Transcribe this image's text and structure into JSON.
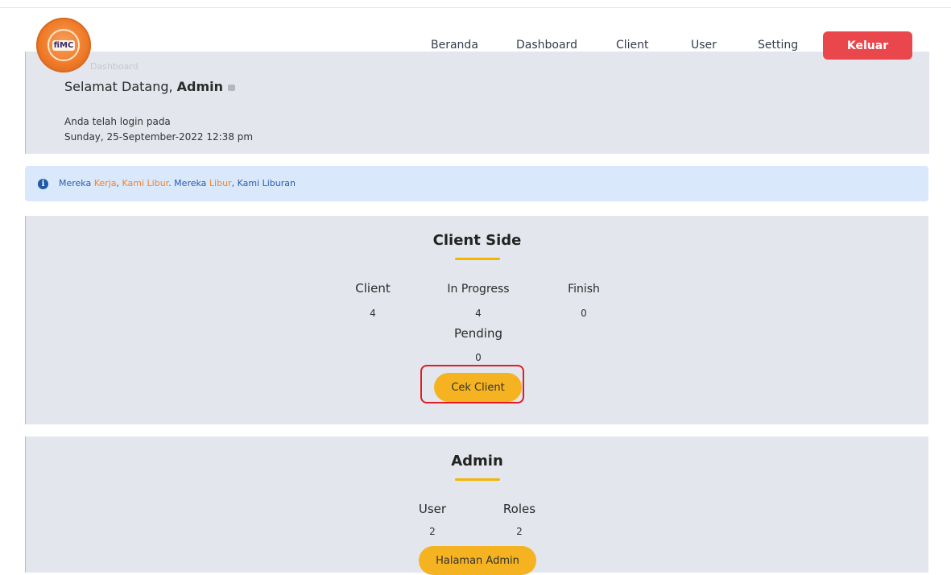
{
  "navbar": {
    "logo_text": "fiMC",
    "links": [
      "Beranda",
      "Dashboard",
      "Client",
      "User",
      "Setting"
    ],
    "logout_label": "Keluar"
  },
  "welcome": {
    "faded_text": "Dashboard",
    "greeting": "Selamat Datang, ",
    "user_name": "Admin",
    "login_label": "Anda telah login pada",
    "login_time": "Sunday, 25-September-2022 12:38 pm"
  },
  "alert": {
    "icon": "info-icon",
    "parts": [
      "Mereka ",
      "Kerja",
      ", ",
      "Kami Libur",
      ". Mereka ",
      "Libur",
      ", ",
      "Kami Liburan"
    ]
  },
  "client_side": {
    "title": "Client Side",
    "stats": [
      {
        "label": "Client",
        "value": "4"
      },
      {
        "label": "In Progress",
        "value": "4"
      },
      {
        "label": "Finish",
        "value": "0"
      },
      {
        "label": "Pending",
        "value": "0"
      }
    ],
    "button_label": "Cek Client"
  },
  "admin": {
    "title": "Admin",
    "stats": [
      {
        "label": "User",
        "value": "2"
      },
      {
        "label": "Roles",
        "value": "2"
      }
    ],
    "button_label": "Halaman Admin"
  },
  "colors": {
    "accent": "#f6b321",
    "logout": "#e9474c",
    "alert_bg": "#d9e8fb",
    "highlight": "#e01c24"
  }
}
